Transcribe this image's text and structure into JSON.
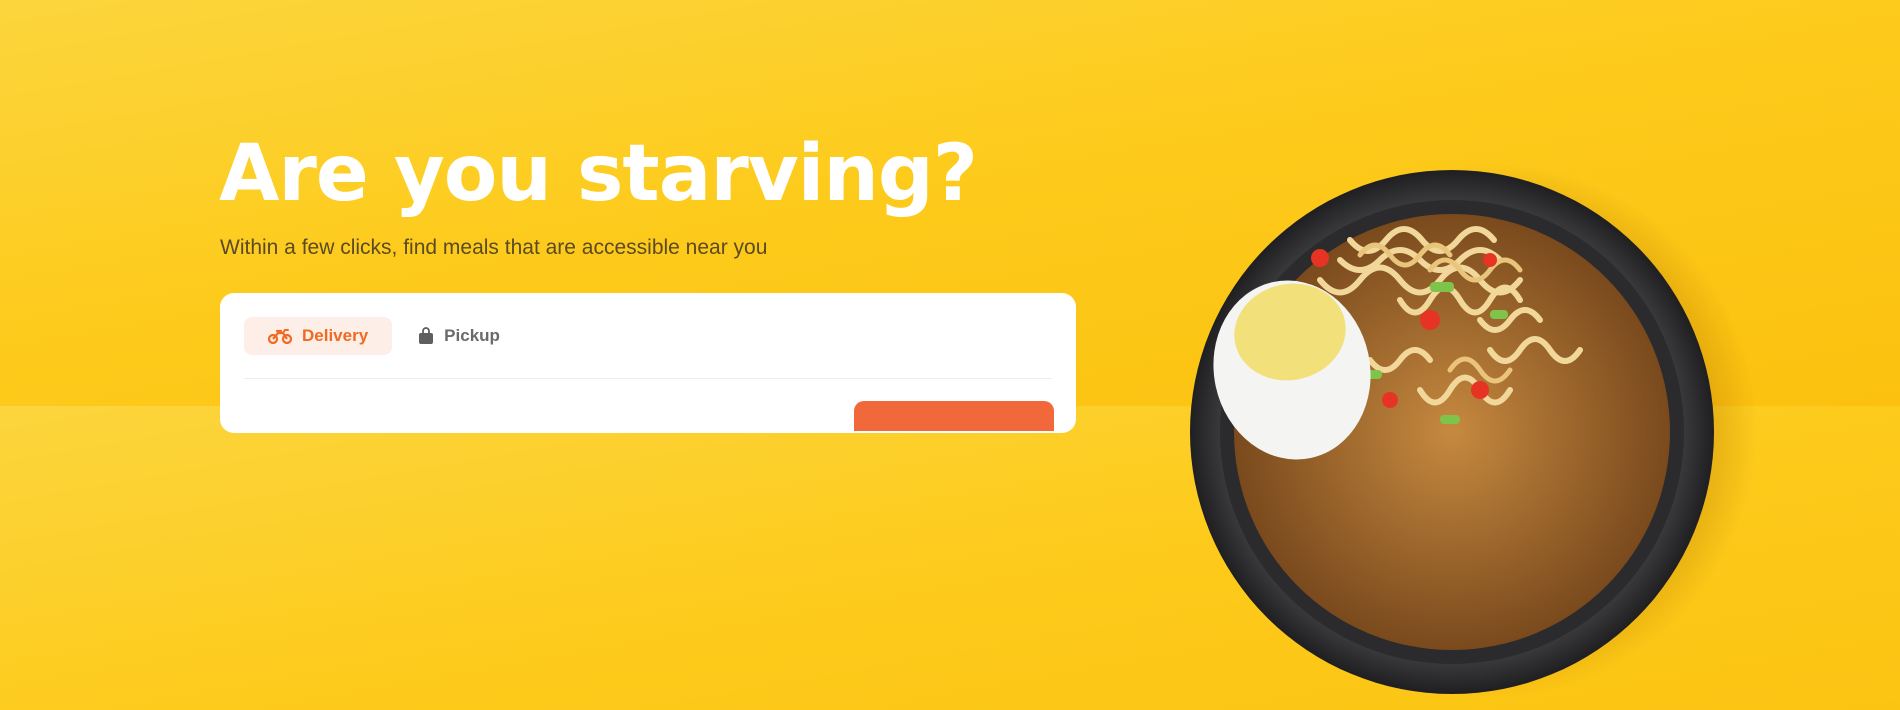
{
  "hero": {
    "headline": "Are you starving?",
    "subline": "Within a few clicks, find meals that are accessible near you"
  },
  "order_tabs": [
    {
      "label": "Delivery",
      "icon": "motorcycle-icon",
      "active": true
    },
    {
      "label": "Pickup",
      "icon": "shopping-bag-icon",
      "active": false
    }
  ],
  "colors": {
    "background": "#fdcb1c",
    "accent": "#f06a22",
    "active_tab_bg": "#fdefe7",
    "cta": "#f1693a"
  },
  "image": {
    "subject": "ramen-bowl-icon"
  }
}
